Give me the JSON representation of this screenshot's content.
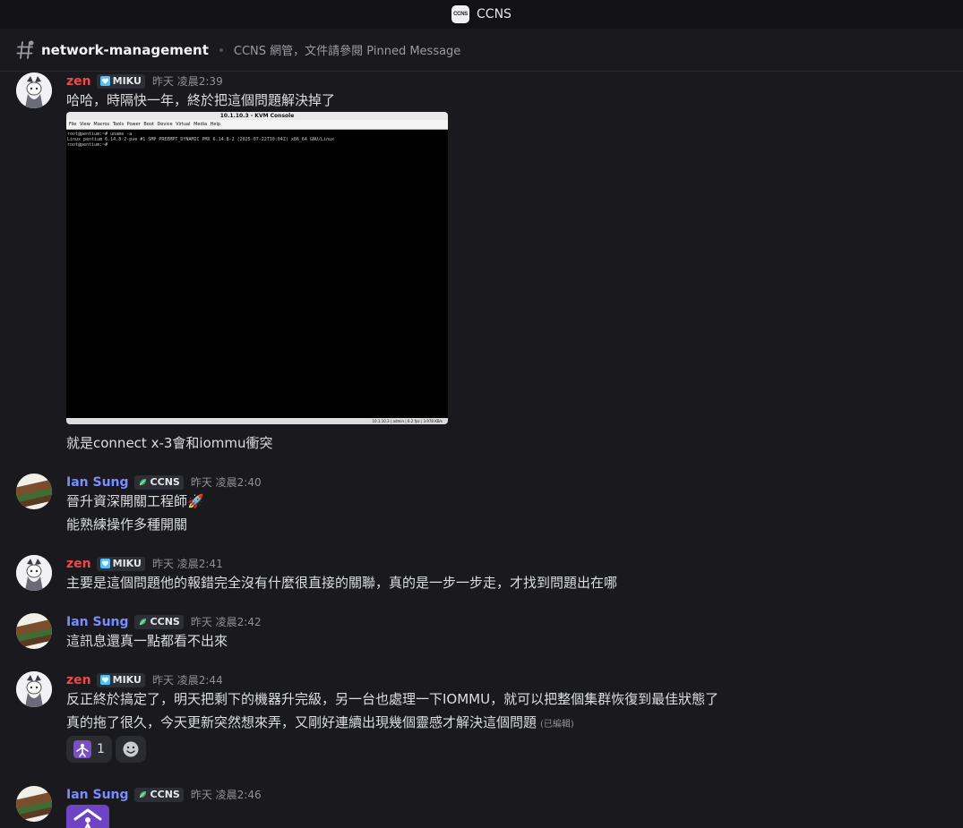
{
  "window": {
    "server_name": "CCNS",
    "server_logo_text": "CCNS"
  },
  "channel": {
    "name": "network-management",
    "topic": "CCNS 網管，文件請參閱 Pinned Message"
  },
  "tags": {
    "miku": "MIKU",
    "ccns": "CCNS"
  },
  "colors": {
    "zen": "#f04747",
    "ian": "#7b8cff",
    "tag_miku": "#4fc3f7",
    "tag_ccns": "#4caf7a"
  },
  "users": {
    "zen": "zen",
    "ian": "Ian Sung"
  },
  "messages": [
    {
      "author": "zen",
      "time": "昨天 凌晨2:39",
      "lines": [
        "哈哈，時隔快一年，終於把這個問題解決掉了",
        "就是connect x-3會和iommu衝突"
      ]
    },
    {
      "author": "ian",
      "time": "昨天 凌晨2:40",
      "lines": [
        "晉升資深開關工程師🚀",
        "能熟練操作多種開關"
      ]
    },
    {
      "author": "zen",
      "time": "昨天 凌晨2:41",
      "lines": [
        "主要是這個問題他的報錯完全沒有什麼很直接的關聯，真的是一步一步走，才找到問題出在哪"
      ]
    },
    {
      "author": "ian",
      "time": "昨天 凌晨2:42",
      "lines": [
        "這訊息還真一點都看不出來"
      ]
    },
    {
      "author": "zen",
      "time": "昨天 凌晨2:44",
      "lines": [
        "反正終於搞定了，明天把剩下的機器升完級，另一台也處理一下IOMMU，就可以把整個集群恢復到最佳狀態了",
        "真的拖了很久，今天更新突然想來弄，又剛好連續出現幾個靈感才解決這個問題"
      ],
      "edited": "(已編輯)",
      "reaction_count": "1"
    },
    {
      "author": "ian",
      "time": "昨天 凌晨2:46",
      "lines": []
    }
  ],
  "kvm": {
    "title": "10.1.10.3 - KVM Console",
    "menu": "File  View  Macros  Tools  Power  Boot Device  Virtual Media  Help",
    "term": [
      "root@pentium:~# uname -a",
      "Linux pentium 6.14.8-2-pve #1 SMP PREEMPT_DYNAMIC PMX 6.14.8-2 (2025-07-22T10:04Z) x86_64 GNU/Linux",
      "root@pentium:~#"
    ],
    "status": "10.1.10.3 | admin | 6.2 fps | 3.978 KB/s"
  }
}
